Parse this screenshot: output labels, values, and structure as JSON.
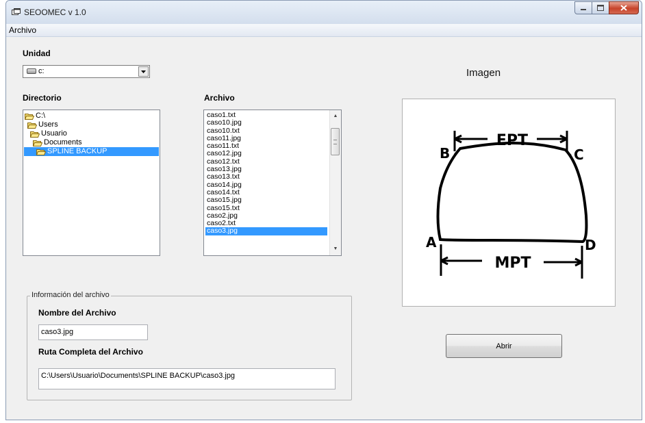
{
  "window": {
    "title": "SEOOMEC v 1.0",
    "icon": "app-window-icon"
  },
  "menu": {
    "items": [
      "Archivo"
    ]
  },
  "unidad": {
    "label": "Unidad",
    "selected": "c:",
    "icon": "drive-icon"
  },
  "directorio": {
    "label": "Directorio",
    "items": [
      "C:\\",
      "Users",
      "Usuario",
      "Documents",
      "SPLINE BACKUP"
    ],
    "selected_index": 4
  },
  "archivo": {
    "label": "Archivo",
    "files": [
      "caso1.txt",
      "caso10.jpg",
      "caso10.txt",
      "caso11.jpg",
      "caso11.txt",
      "caso12.jpg",
      "caso12.txt",
      "caso13.jpg",
      "caso13.txt",
      "caso14.jpg",
      "caso14.txt",
      "caso15.jpg",
      "caso15.txt",
      "caso2.jpg",
      "caso2.txt",
      "caso3.jpg"
    ],
    "selected_index": 15
  },
  "info": {
    "group_title": "Información del  archivo",
    "name_label": "Nombre del Archivo",
    "name_value": "caso3.jpg",
    "path_label": "Ruta Completa del Archivo",
    "path_value": "C:\\Users\\Usuario\\Documents\\SPLINE BACKUP\\caso3.jpg"
  },
  "imagen": {
    "label": "Imagen",
    "annotations": {
      "top": "EPT",
      "bottom": "MPT",
      "corner_b": "B",
      "corner_c": "C",
      "corner_a": "A",
      "corner_d": "D"
    }
  },
  "buttons": {
    "abrir": "Abrir"
  },
  "colors": {
    "selection": "#3399ff",
    "close_button": "#c7432a",
    "window_bg": "#f0f0f0"
  }
}
